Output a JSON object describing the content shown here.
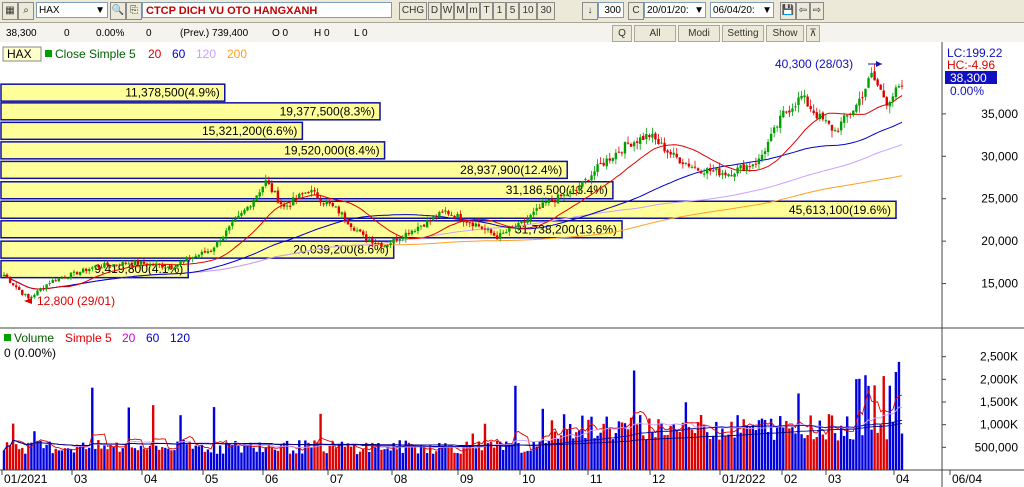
{
  "toolbar": {
    "symbol": "HAX",
    "company": "CTCP DICH VU OTO HANGXANH",
    "chg_label": "CHG",
    "period_buttons": [
      "D",
      "W",
      "M",
      "m",
      "T",
      "1",
      "5",
      "10",
      "30"
    ],
    "bar_count": "300",
    "c_label": "C",
    "date_from": "20/01/20:",
    "date_to": "06/04/20:"
  },
  "infobar": {
    "price": "38,300",
    "change": "0",
    "change_pct": "0.00%",
    "vol": "0",
    "prev": "(Prev.) 739,400",
    "o": "O 0",
    "h": "H 0",
    "l": "L 0",
    "q_label": "Q",
    "all_label": "All",
    "modi_label": "Modi",
    "setting_label": "Setting",
    "show_label": "Show"
  },
  "price_panel": {
    "symbol_tag": "HAX",
    "ma_label": "Close Simple 5",
    "ma_periods": [
      "20",
      "60",
      "120",
      "200"
    ],
    "lc": "LC:199.22",
    "hc": "HC:-4.96",
    "last_price": "38,300",
    "last_pct": "0.00%",
    "high_note": "40,300 (28/03)",
    "low_note": "12,800 (29/01)"
  },
  "volume_panel": {
    "label": "Volume",
    "ma_label": "Simple 5",
    "ma_periods": [
      "20",
      "60",
      "120"
    ],
    "value": "0 (0.00%)"
  },
  "colors": {
    "up": "#00a000",
    "down": "#e00000",
    "vol_up": "#0000e0",
    "vol_down": "#e00000",
    "ma5": "#e00000",
    "ma20": "#0000cc",
    "ma60": "#c8a0ff",
    "ma120": "#ffa020",
    "vp_fill": "#ffff99",
    "vp_border": "#1010a0",
    "symbol_text": "#c00000"
  },
  "chart_data": [
    {
      "type": "candlestick",
      "ylim": [
        10000,
        43000
      ],
      "y_ticks": [
        "35,000",
        "30,000",
        "25,000",
        "20,000",
        "15,000"
      ],
      "y_tick_values": [
        35000,
        30000,
        25000,
        20000,
        15000
      ],
      "x_ticks": [
        "01/2021",
        "03",
        "04",
        "05",
        "06",
        "07",
        "08",
        "09",
        "10",
        "11",
        "12",
        "01/2022",
        "02",
        "03",
        "04",
        "06/04"
      ],
      "keypoints": [
        {
          "i": 0,
          "p": 16000
        },
        {
          "i": 8,
          "p": 13200
        },
        {
          "i": 15,
          "p": 15200
        },
        {
          "i": 30,
          "p": 17000
        },
        {
          "i": 42,
          "p": 17500
        },
        {
          "i": 55,
          "p": 17000
        },
        {
          "i": 68,
          "p": 19000
        },
        {
          "i": 80,
          "p": 24000
        },
        {
          "i": 86,
          "p": 27000
        },
        {
          "i": 92,
          "p": 24000
        },
        {
          "i": 100,
          "p": 26000
        },
        {
          "i": 110,
          "p": 23500
        },
        {
          "i": 118,
          "p": 20500
        },
        {
          "i": 125,
          "p": 19500
        },
        {
          "i": 135,
          "p": 21500
        },
        {
          "i": 145,
          "p": 23500
        },
        {
          "i": 155,
          "p": 22000
        },
        {
          "i": 162,
          "p": 20500
        },
        {
          "i": 170,
          "p": 22000
        },
        {
          "i": 178,
          "p": 24500
        },
        {
          "i": 188,
          "p": 26000
        },
        {
          "i": 196,
          "p": 29000
        },
        {
          "i": 205,
          "p": 31500
        },
        {
          "i": 212,
          "p": 32500
        },
        {
          "i": 220,
          "p": 30000
        },
        {
          "i": 228,
          "p": 28500
        },
        {
          "i": 238,
          "p": 28000
        },
        {
          "i": 248,
          "p": 29500
        },
        {
          "i": 256,
          "p": 35000
        },
        {
          "i": 262,
          "p": 37000
        },
        {
          "i": 268,
          "p": 34500
        },
        {
          "i": 273,
          "p": 33000
        },
        {
          "i": 280,
          "p": 36000
        },
        {
          "i": 285,
          "p": 39500
        },
        {
          "i": 290,
          "p": 36500
        },
        {
          "i": 295,
          "p": 38300
        }
      ],
      "volume_profile": [
        {
          "label": "11,378,500(4.9%)",
          "low": 36500,
          "high": 38500
        },
        {
          "label": "19,377,500(8.3%)",
          "low": 34300,
          "high": 36300
        },
        {
          "label": "15,321,200(6.6%)",
          "low": 32000,
          "high": 34000
        },
        {
          "label": "19,520,000(8.4%)",
          "low": 29700,
          "high": 31700
        },
        {
          "label": "28,937,900(12.4%)",
          "low": 27400,
          "high": 29400
        },
        {
          "label": "31,186,500(13.4%)",
          "low": 25000,
          "high": 27000
        },
        {
          "label": "45,613,100(19.6%)",
          "low": 22700,
          "high": 24700
        },
        {
          "label": "31,738,200(13.6%)",
          "low": 20400,
          "high": 22400
        },
        {
          "label": "20,039,200(8.6%)",
          "low": 18000,
          "high": 20000
        },
        {
          "label": "9,419,800(4.1%)",
          "low": 15700,
          "high": 17700
        }
      ]
    },
    {
      "type": "bar",
      "ylim": [
        0,
        3000000
      ],
      "y_ticks": [
        "2,500K",
        "2,000K",
        "1,500K",
        "1,000K",
        "500,000"
      ],
      "y_tick_values": [
        2500000,
        2000000,
        1500000,
        1000000,
        500000
      ]
    }
  ]
}
